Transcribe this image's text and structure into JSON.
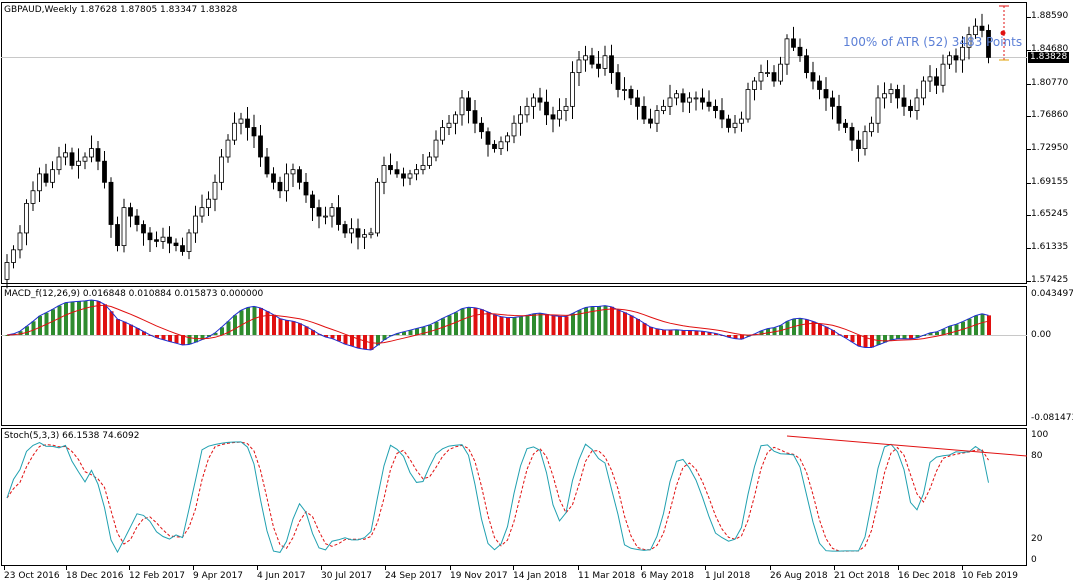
{
  "main_chart": {
    "header": "GBPAUD,Weekly  1.87628 1.87805 1.83347 1.83828",
    "atr_label": "100% of ATR (52) 3483 Points",
    "price_axis": [
      "1.88590",
      "1.84680",
      "1.80770",
      "1.76860",
      "1.72950",
      "1.69155",
      "1.65245",
      "1.61335",
      "1.57425"
    ],
    "current_price": "1.83828"
  },
  "macd_panel": {
    "header": "MACD_f(12,26,9) 0.016848 0.010884 0.015873 0.000000",
    "axis": [
      "0.043497",
      "0.00",
      "-0.081473"
    ]
  },
  "stoch_panel": {
    "header": "Stoch(5,3,3) 66.1538 74.6092",
    "axis": [
      "100",
      "80",
      "20",
      "0"
    ]
  },
  "time_axis": [
    "23 Oct 2016",
    "18 Dec 2016",
    "12 Feb 2017",
    "9 Apr 2017",
    "4 Jun 2017",
    "30 Jul 2017",
    "24 Sep 2017",
    "19 Nov 2017",
    "14 Jan 2018",
    "11 Mar 2018",
    "6 May 2018",
    "1 Jul 2018",
    "26 Aug 2018",
    "21 Oct 2018",
    "16 Dec 2018",
    "10 Feb 2019"
  ],
  "colors": {
    "bull_body": "#ffffff",
    "bear_body": "#000000",
    "macd_up": "#2e8b2e",
    "macd_down": "#e01010",
    "macd_line": "#1f2fd0",
    "signal_line": "#e01010",
    "stoch_main": "#20a0b0",
    "stoch_signal": "#e01010",
    "trendline": "#e01010",
    "atr_text": "#5b7fd6"
  },
  "chart_data": {
    "type": "candlestick",
    "closes": [
      1.595,
      1.61,
      1.63,
      1.665,
      1.68,
      1.7,
      1.69,
      1.705,
      1.72,
      1.725,
      1.71,
      1.715,
      1.72,
      1.73,
      1.715,
      1.69,
      1.64,
      1.615,
      1.66,
      1.65,
      1.64,
      1.63,
      1.622,
      1.62,
      1.625,
      1.618,
      1.615,
      1.608,
      1.63,
      1.65,
      1.66,
      1.67,
      1.69,
      1.72,
      1.74,
      1.76,
      1.765,
      1.755,
      1.745,
      1.72,
      1.7,
      1.69,
      1.68,
      1.7,
      1.705,
      1.69,
      1.675,
      1.66,
      1.65,
      1.65,
      1.66,
      1.64,
      1.63,
      1.635,
      1.625,
      1.628,
      1.63,
      1.69,
      1.71,
      1.705,
      1.7,
      1.695,
      1.7,
      1.705,
      1.71,
      1.72,
      1.74,
      1.755,
      1.76,
      1.77,
      1.79,
      1.775,
      1.76,
      1.75,
      1.735,
      1.73,
      1.738,
      1.745,
      1.76,
      1.77,
      1.78,
      1.79,
      1.785,
      1.77,
      1.765,
      1.775,
      1.78,
      1.82,
      1.835,
      1.84,
      1.83,
      1.825,
      1.84,
      1.82,
      1.8,
      1.8,
      1.79,
      1.78,
      1.765,
      1.76,
      1.775,
      1.78,
      1.79,
      1.795,
      1.785,
      1.79,
      1.79,
      1.785,
      1.78,
      1.775,
      1.765,
      1.755,
      1.76,
      1.765,
      1.8,
      1.81,
      1.82,
      1.82,
      1.81,
      1.83,
      1.86,
      1.85,
      1.84,
      1.82,
      1.81,
      1.8,
      1.79,
      1.78,
      1.76,
      1.755,
      1.74,
      1.73,
      1.75,
      1.76,
      1.79,
      1.795,
      1.8,
      1.79,
      1.78,
      1.775,
      1.79,
      1.81,
      1.815,
      1.805,
      1.83,
      1.84,
      1.835,
      1.85,
      1.865,
      1.875,
      1.87,
      1.838
    ]
  }
}
